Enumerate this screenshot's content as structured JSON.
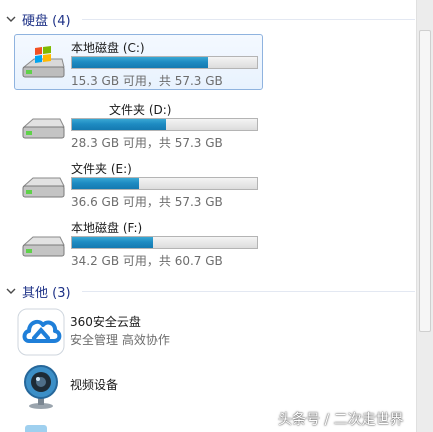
{
  "groups": {
    "drives": {
      "title": "硬盘 (4)"
    },
    "other": {
      "title": "其他 (3)"
    }
  },
  "drives": [
    {
      "name": "本地磁盘 (C:)",
      "used_fraction": 0.733,
      "info": "15.3 GB 可用，共 57.3 GB",
      "selected": true,
      "icon": "windows-drive-icon"
    },
    {
      "name": "文件夹 (D:)",
      "used_fraction": 0.506,
      "info": "28.3 GB 可用，共 57.3 GB",
      "selected": false,
      "icon": "hard-drive-icon"
    },
    {
      "name": "文件夹 (E:)",
      "used_fraction": 0.361,
      "info": "36.6 GB 可用，共 57.3 GB",
      "selected": false,
      "icon": "hard-drive-icon"
    },
    {
      "name": "本地磁盘 (F:)",
      "used_fraction": 0.437,
      "info": "34.2 GB 可用，共 60.7 GB",
      "selected": false,
      "icon": "hard-drive-icon"
    }
  ],
  "others": [
    {
      "name": "360安全云盘",
      "sub": "安全管理 高效协作",
      "icon": "cloud-icon"
    },
    {
      "name": "视频设备",
      "sub": "",
      "icon": "webcam-icon"
    }
  ],
  "watermark": "头条号 / 二次走世界",
  "colors": {
    "group_title": "#1e3287",
    "bar_fill": "#1e8bc2",
    "selection_border": "#8fb3df"
  }
}
